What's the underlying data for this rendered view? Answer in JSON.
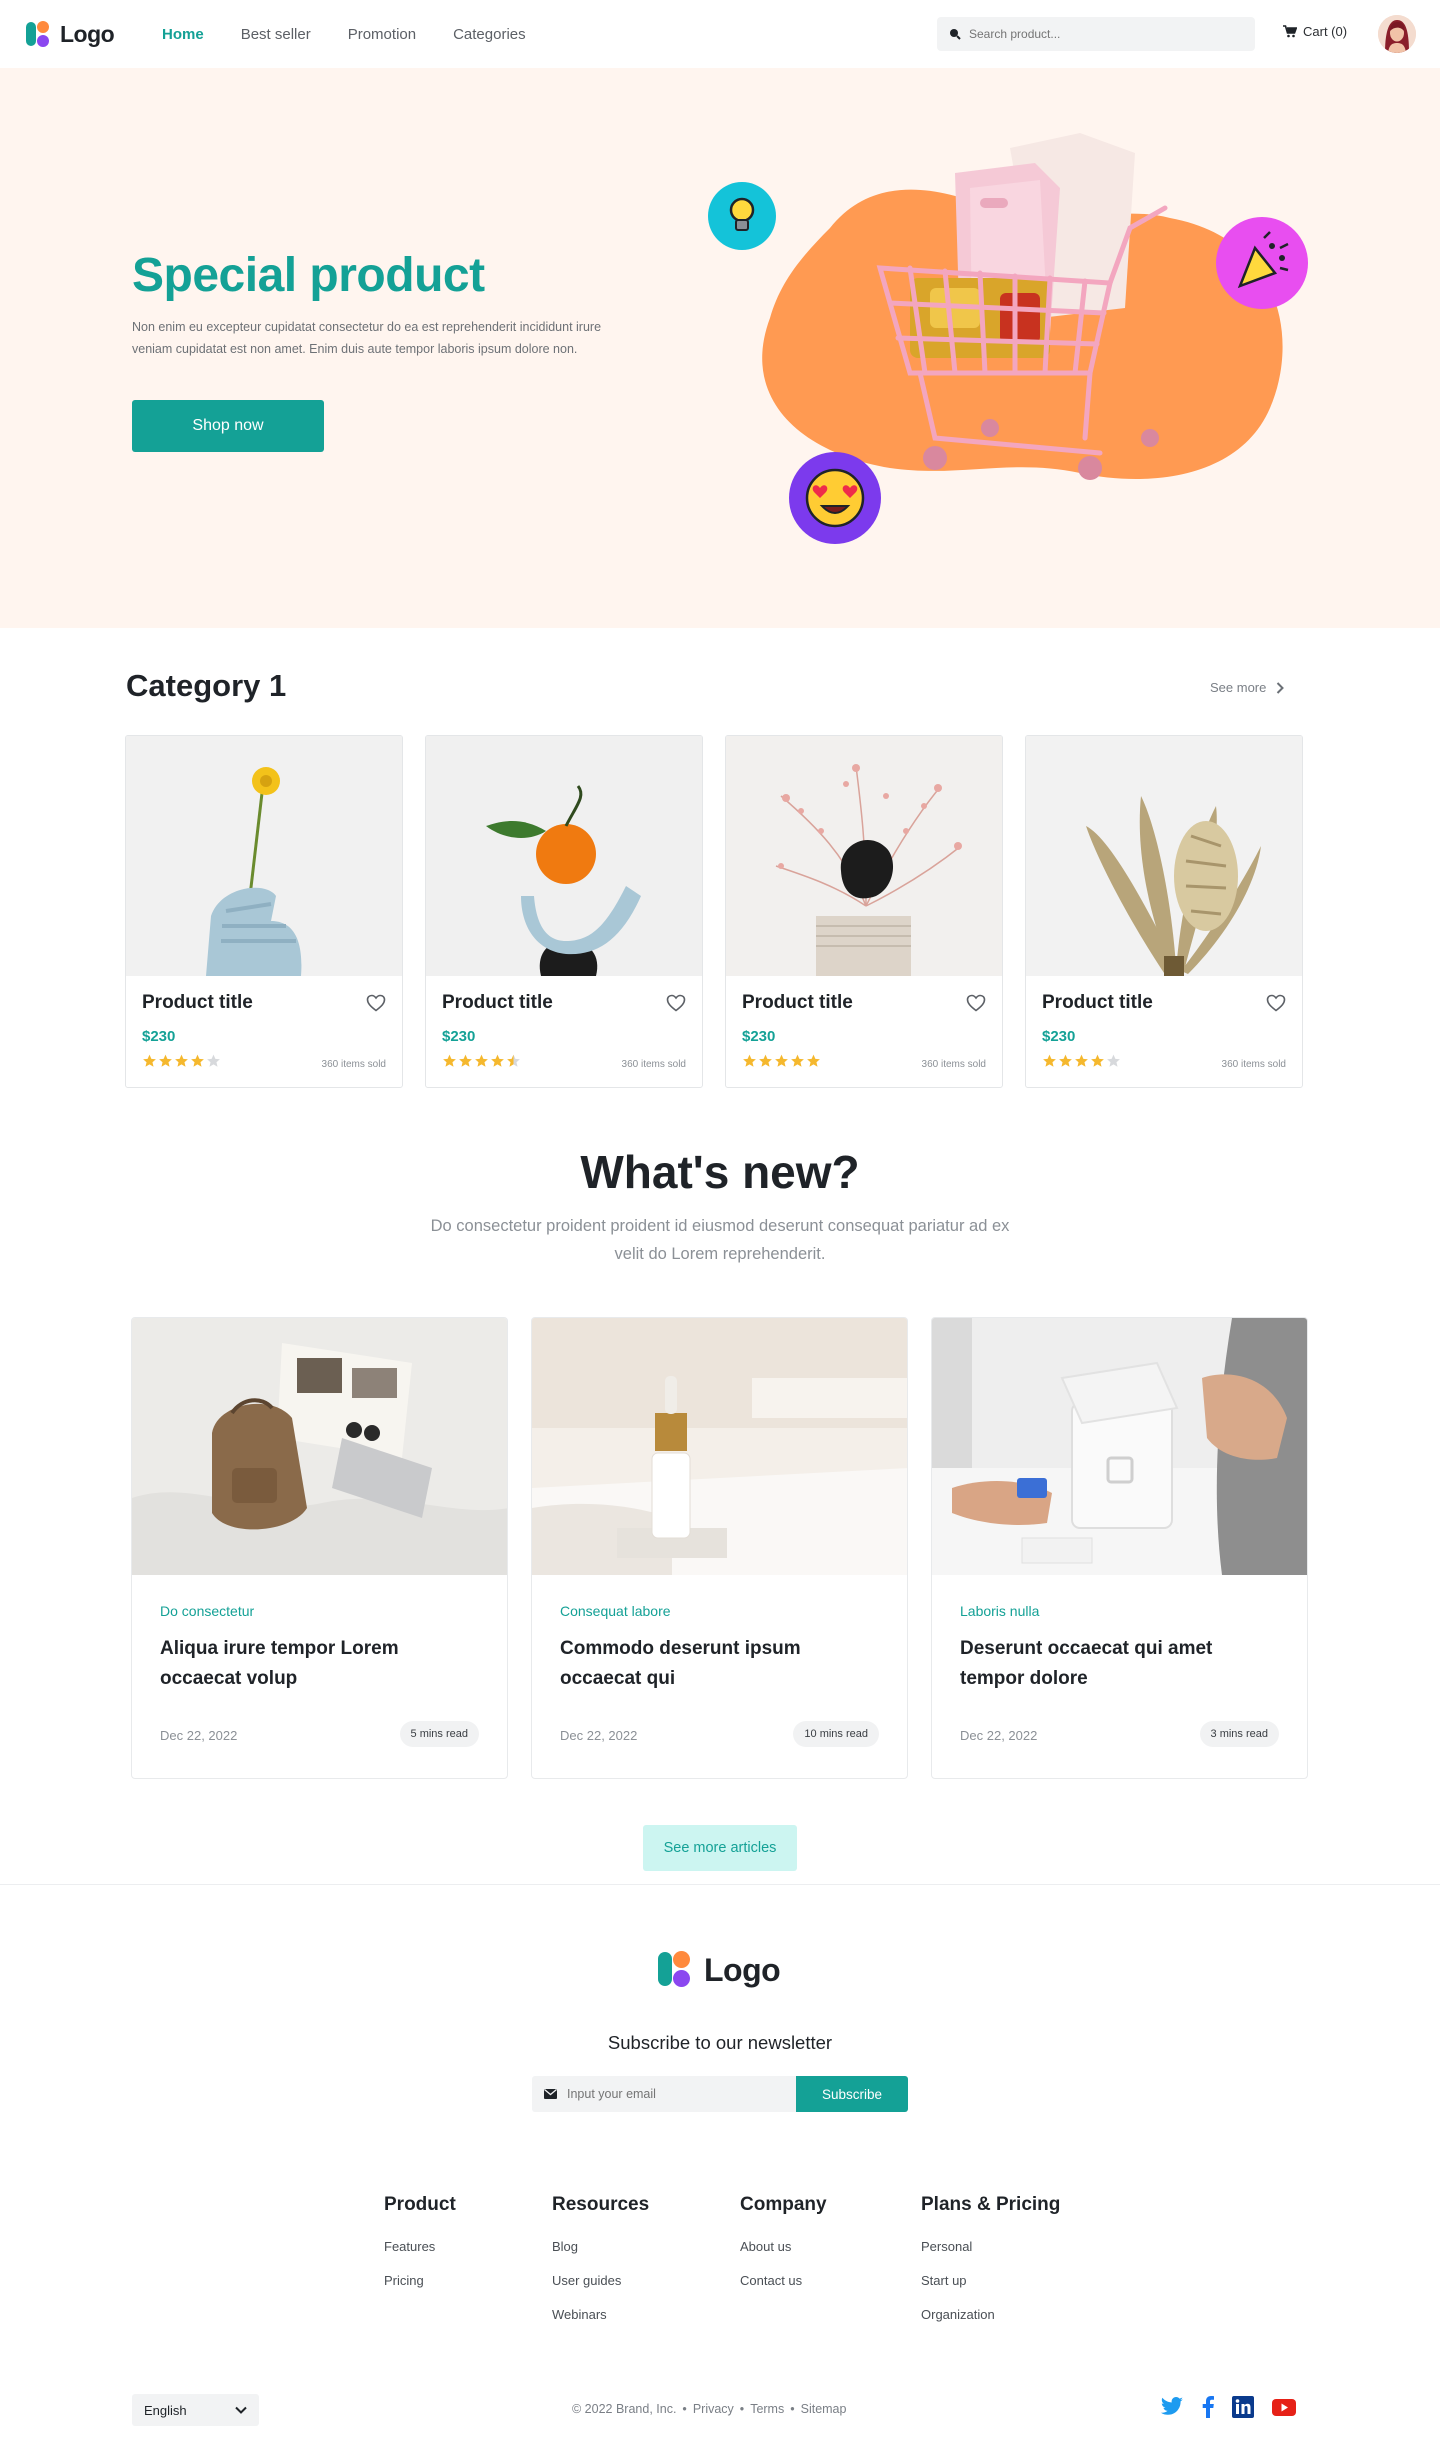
{
  "nav": {
    "logo_text": "Logo",
    "links": [
      {
        "label": "Home",
        "active": true
      },
      {
        "label": "Best seller",
        "active": false
      },
      {
        "label": "Promotion",
        "active": false
      },
      {
        "label": "Categories",
        "active": false
      }
    ],
    "search_placeholder": "Search product...",
    "cart_label": "Cart (0)"
  },
  "hero": {
    "title": "Special product",
    "description": "Non enim eu excepteur cupidatat consectetur do ea est reprehenderit incididunt irure veniam cupidatat est non amet. Enim duis aute tempor laboris ipsum dolore non.",
    "cta_label": "Shop now"
  },
  "category": {
    "title": "Category 1",
    "see_more": "See more",
    "products": [
      {
        "title": "Product title",
        "price": "$230",
        "rating": 4,
        "sold": "360 items sold"
      },
      {
        "title": "Product title",
        "price": "$230",
        "rating": 4.5,
        "sold": "360 items sold"
      },
      {
        "title": "Product title",
        "price": "$230",
        "rating": 5,
        "sold": "360 items sold"
      },
      {
        "title": "Product title",
        "price": "$230",
        "rating": 4,
        "sold": "360 items sold"
      }
    ]
  },
  "whats_new": {
    "title": "What's new?",
    "description": "Do consectetur proident proident id eiusmod deserunt consequat pariatur ad ex velit do Lorem reprehenderit.",
    "articles": [
      {
        "category": "Do consectetur",
        "title": "Aliqua irure tempor Lorem occaecat volup",
        "date": "Dec 22, 2022",
        "read_time": "5 mins read"
      },
      {
        "category": "Consequat labore",
        "title": "Commodo deserunt ipsum occaecat qui",
        "date": "Dec 22, 2022",
        "read_time": "10 mins read"
      },
      {
        "category": "Laboris nulla",
        "title": "Deserunt occaecat qui amet tempor dolore",
        "date": "Dec 22, 2022",
        "read_time": "3 mins read"
      }
    ],
    "see_more_label": "See more articles"
  },
  "footer": {
    "logo_text": "Logo",
    "newsletter_title": "Subscribe to our newsletter",
    "email_placeholder": "Input your email",
    "subscribe_label": "Subscribe",
    "columns": [
      {
        "heading": "Product",
        "links": [
          "Features",
          "Pricing"
        ]
      },
      {
        "heading": "Resources",
        "links": [
          "Blog",
          "User guides",
          "Webinars"
        ]
      },
      {
        "heading": "Company",
        "links": [
          "About us",
          "Contact us"
        ]
      },
      {
        "heading": "Plans & Pricing",
        "links": [
          "Personal",
          "Start up",
          "Organization"
        ]
      }
    ],
    "language": "English",
    "copyright": "© 2022 Brand, Inc.",
    "legal_links": [
      "Privacy",
      "Terms",
      "Sitemap"
    ],
    "socials": [
      "twitter-icon",
      "facebook-icon",
      "linkedin-icon",
      "youtube-icon"
    ]
  },
  "colors": {
    "accent": "#14a196",
    "hero_bg": "#fff5ef",
    "hero_blob": "#ff9a52",
    "star": "#f5b82e",
    "light_button": "#ccf5f1"
  }
}
